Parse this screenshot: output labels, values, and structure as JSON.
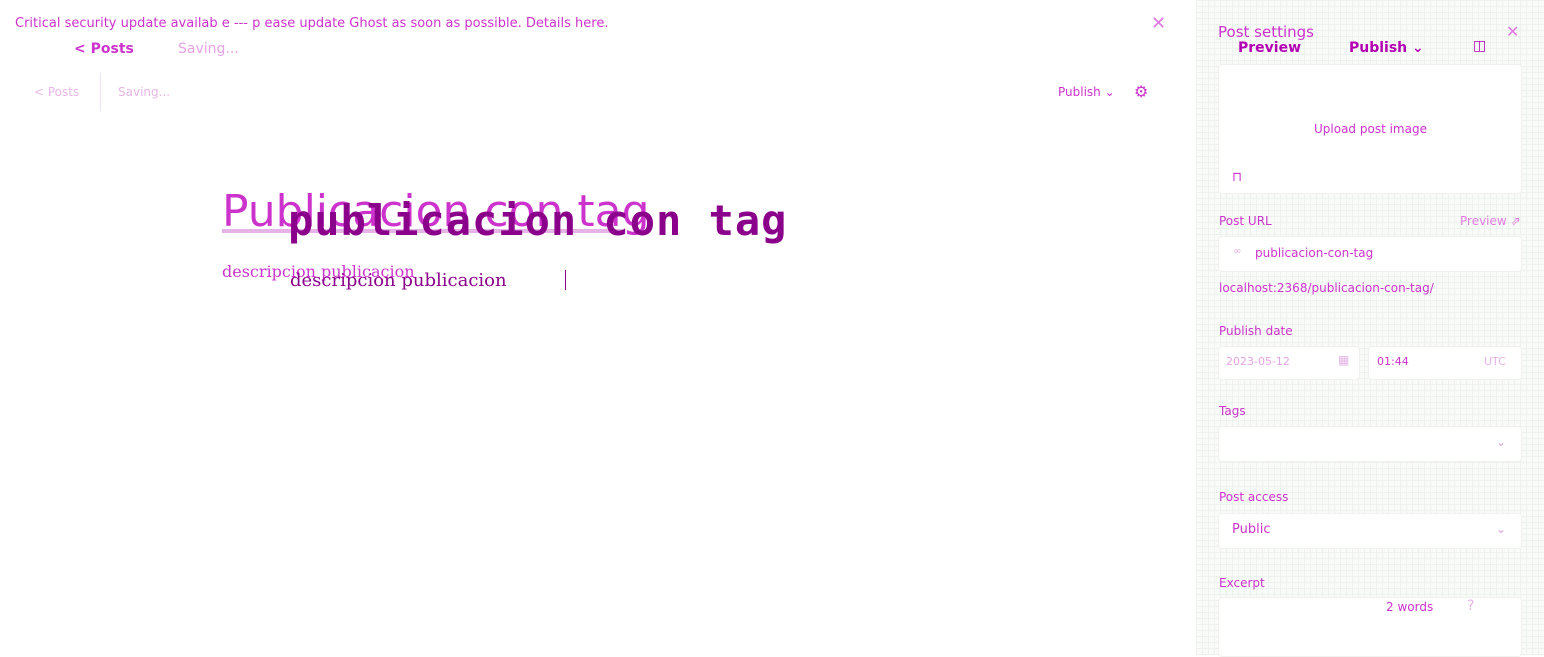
{
  "notice": {
    "text": "Critical security update availab e --- p ease update Ghost as soon as possible. Details here.",
    "close": "✕"
  },
  "nav": {
    "back": "<  Posts",
    "saving": "Saving..."
  },
  "editor_header": {
    "back": "<  Posts",
    "saving": "Saving...",
    "publish": "Publish ⌄",
    "settings_icon": "⚙"
  },
  "post": {
    "title_ghost": "Publicacion con tag",
    "title": "publicacion con tag",
    "subtitle_ghost": "descripcion publicacion",
    "subtitle": "descripcion publicacion"
  },
  "panel": {
    "title": "Post settings",
    "close": "✕",
    "ghost_preview": "Preview",
    "ghost_publish": "Publish ⌄",
    "ghost_sidebar_icon": "◫",
    "upload_label": "Upload post image",
    "unsplash_icon": "⊓",
    "url_label": "Post URL",
    "url_preview": "Preview ⇗",
    "url_link_icon": "∞",
    "url_value": "publicacion-con-tag",
    "url_full": "localhost:2368/publicacion-con-tag/",
    "date_label": "Publish date",
    "date_value": "2023-05-12",
    "date_cal_icon": "▦",
    "time_value": "01:44",
    "time_zone": "UTC",
    "tags_label": "Tags",
    "tags_chevron": "⌄",
    "access_label": "Post access",
    "access_value": "Public",
    "access_chevron": "⌄",
    "excerpt_label": "Excerpt",
    "excerpt_words": "2 words",
    "excerpt_help": "?"
  },
  "colors": {
    "accent": "#cc33cc",
    "text_dark": "#8a008a",
    "panel_bg": "#f8fbf8"
  }
}
